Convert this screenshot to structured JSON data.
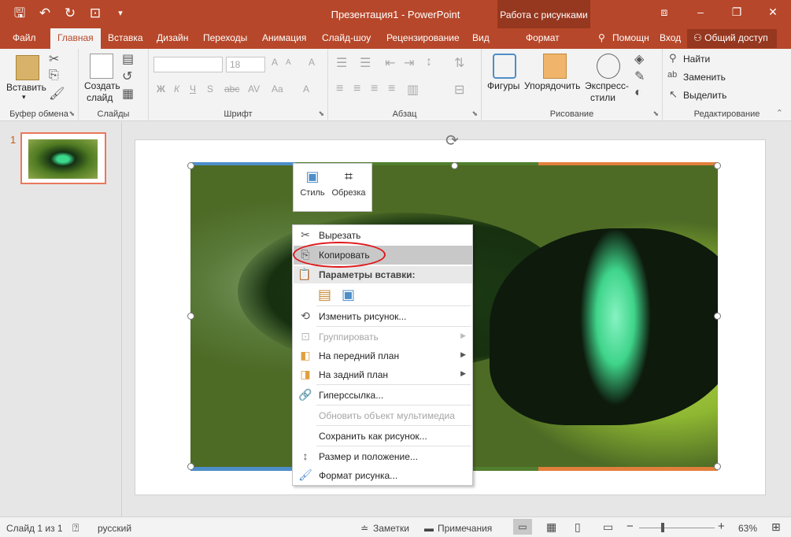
{
  "window": {
    "title": "Презентация1 - PowerPoint",
    "context_group": "Работа с рисунками",
    "minimize": "–",
    "restore": "❐",
    "close": "✕",
    "ribbon_display": "⧈"
  },
  "tabs": [
    {
      "label": "Файл"
    },
    {
      "label": "Главная"
    },
    {
      "label": "Вставка"
    },
    {
      "label": "Дизайн"
    },
    {
      "label": "Переходы"
    },
    {
      "label": "Анимация"
    },
    {
      "label": "Слайд-шоу"
    },
    {
      "label": "Рецензирование"
    },
    {
      "label": "Вид"
    },
    {
      "label": "Формат"
    },
    {
      "label": "Помощн"
    },
    {
      "label": "Вход"
    }
  ],
  "share_label": "Общий доступ",
  "ribbon": {
    "clipboard": {
      "paste": "Вставить",
      "label": "Буфер обмена"
    },
    "slides": {
      "new_slide_1": "Создать",
      "new_slide_2": "слайд",
      "label": "Слайды"
    },
    "font": {
      "size": "18",
      "bold": "Ж",
      "italic": "К",
      "underline": "Ч",
      "strike": "S",
      "spacing": "abc",
      "fontcolor": "А",
      "grow": "A",
      "shrink": "A",
      "clear": "A",
      "case": "Aa",
      "label": "Шрифт"
    },
    "paragraph": {
      "label": "Абзац"
    },
    "drawing": {
      "shapes": "Фигуры",
      "arrange": "Упорядочить",
      "styles_1": "Экспресс-",
      "styles_2": "стили",
      "label": "Рисование"
    },
    "editing": {
      "find": "Найти",
      "replace": "Заменить",
      "select": "Выделить",
      "label": "Редактирование"
    }
  },
  "slide_number": "1",
  "minibar": {
    "style": "Стиль",
    "crop": "Обрезка"
  },
  "context_menu": {
    "cut": "Вырезать",
    "copy": "Копировать",
    "paste_options": "Параметры вставки:",
    "change_picture": "Изменить рисунок...",
    "group": "Группировать",
    "bring_forward": "На передний план",
    "send_backward": "На задний план",
    "hyperlink": "Гиперссылка...",
    "update_media": "Обновить объект мультимедиа",
    "save_as_picture": "Сохранить как рисунок...",
    "size_position": "Размер и положение...",
    "format_picture": "Формат рисунка..."
  },
  "status": {
    "slide": "Слайд 1 из 1",
    "language": "русский",
    "notes": "Заметки",
    "comments": "Примечания",
    "zoom": "63%"
  },
  "colors": {
    "accent": "#b7472a",
    "context": "#96371f"
  }
}
